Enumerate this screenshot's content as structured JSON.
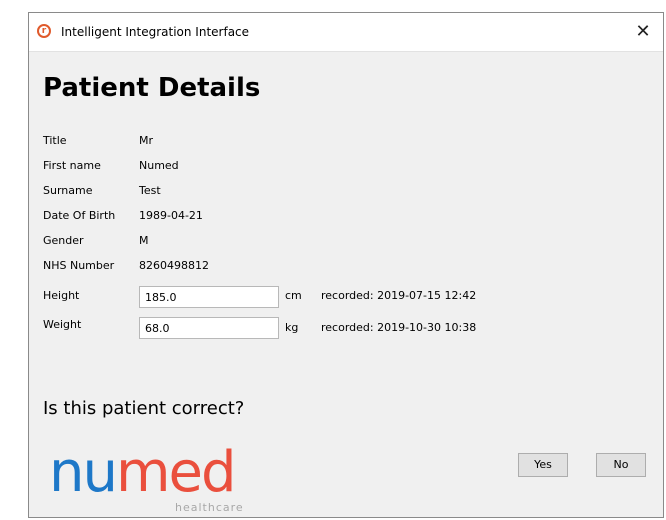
{
  "window": {
    "title": "Intelligent Integration Interface",
    "close_glyph": "✕",
    "app_icon_letter": "r"
  },
  "page_title": "Patient Details",
  "details": [
    {
      "label": "Title",
      "value": "Mr"
    },
    {
      "label": "First name",
      "value": "Numed"
    },
    {
      "label": "Surname",
      "value": "Test"
    },
    {
      "label": "Date Of Birth",
      "value": "1989-04-21"
    },
    {
      "label": "Gender",
      "value": "M"
    },
    {
      "label": "NHS Number",
      "value": "8260498812"
    }
  ],
  "measurements": {
    "height": {
      "label": "Height",
      "value": "185.0",
      "unit": "cm",
      "recorded": "recorded: 2019-07-15 12:42"
    },
    "weight": {
      "label": "Weight",
      "value": "68.0",
      "unit": "kg",
      "recorded": "recorded: 2019-10-30 10:38"
    }
  },
  "question": "Is this patient correct?",
  "logo": {
    "nu": "nu",
    "med": "med",
    "sub": "healthcare"
  },
  "buttons": {
    "yes": "Yes",
    "no": "No"
  },
  "colors": {
    "brand_blue": "#1e78c8",
    "brand_red": "#ea4f3d",
    "icon_orange": "#e05a2b"
  }
}
